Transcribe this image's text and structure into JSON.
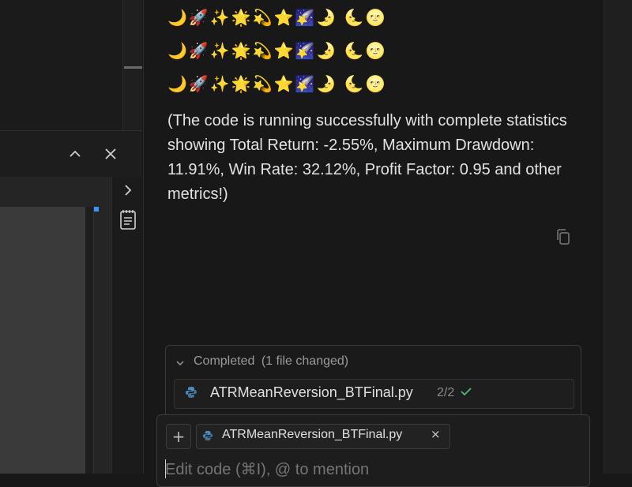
{
  "panel_header": {
    "collapse_icon": "chevron-up-icon",
    "close_icon": "close-icon"
  },
  "side_rail": {
    "expand_icon": "chevron-right-icon",
    "outline_icon": "notepad-icon"
  },
  "chat": {
    "emoji_rows": [
      "🌙🚀✨🌟💫⭐🌠🌛 🌜🌝",
      "🌙🚀✨🌟💫⭐🌠🌛 🌜🌝",
      "🌙🚀✨🌟💫⭐🌠🌛 🌜🌝"
    ],
    "message": "(The code is running successfully with complete statistics showing Total Return: -2.55%, Maximum Drawdown: 11.91%, Win Rate: 32.12%, Profit Factor: 0.95 and other metrics!)",
    "copy_icon": "copy-icon"
  },
  "changes": {
    "status": "Completed",
    "summary": "(1 file changed)",
    "file": {
      "name": "ATRMeanReversion_BTFinal.py",
      "count": "2/2",
      "icon": "python-icon"
    }
  },
  "composer": {
    "add_label": "+",
    "context_chip": "ATRMeanReversion_BTFinal.py",
    "chip_close": "×",
    "placeholder": "Edit code (⌘I), @ to mention"
  },
  "colors": {
    "background": "#181818",
    "accent_blue": "#3794ff",
    "check_green": "#4ec27a",
    "python_blue": "#4b8bbe"
  }
}
